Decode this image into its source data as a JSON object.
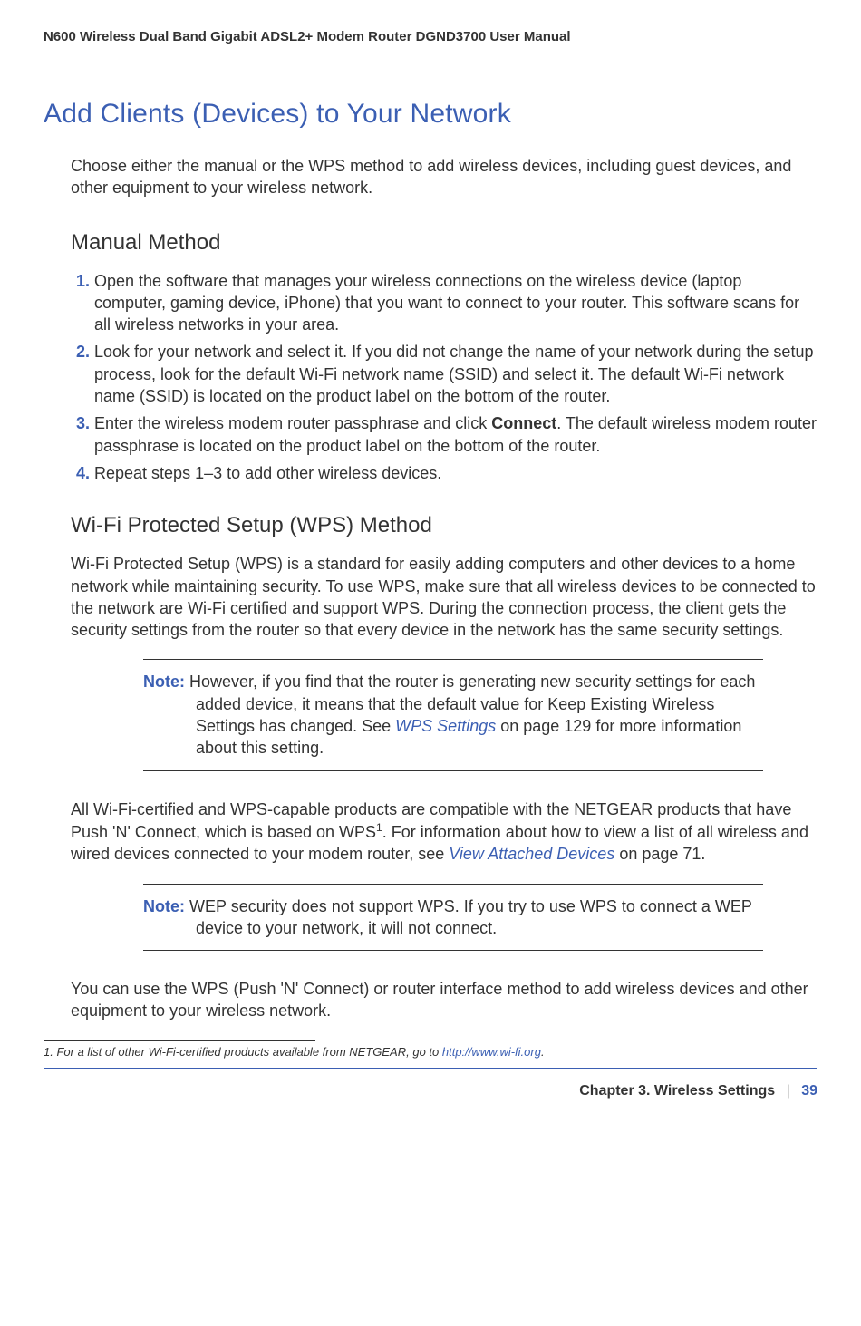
{
  "header": {
    "manual_title": "N600 Wireless Dual Band Gigabit ADSL2+ Modem Router DGND3700 User Manual"
  },
  "section": {
    "title": "Add Clients (Devices) to Your Network",
    "intro": "Choose either the manual or the WPS method to add wireless devices, including guest devices, and other equipment to your wireless network."
  },
  "manual": {
    "title": "Manual Method",
    "steps": [
      "Open the software that manages your wireless connections on the wireless device (laptop computer, gaming device, iPhone) that you want to connect to your router. This software scans for all wireless networks in your area.",
      "Look for your network and select it. If you did not change the name of your network during the setup process, look for the default Wi-Fi network name (SSID) and select it. The default Wi-Fi network name (SSID) is located on the product label on the bottom of the router.",
      "Enter the wireless modem router passphrase and click Connect. The default wireless modem router passphrase is located on the product label on the bottom of the router.",
      "Repeat steps 1–3 to add other wireless devices."
    ],
    "step3_pre": "Enter the wireless modem router passphrase and click ",
    "step3_bold": "Connect",
    "step3_post": ". The default wireless modem router passphrase is located on the product label on the bottom of the router."
  },
  "wps": {
    "title": "Wi-Fi Protected Setup (WPS) Method",
    "intro": "Wi-Fi Protected Setup (WPS) is a standard for easily adding computers and other devices to a home network while maintaining security. To use WPS, make sure that all wireless devices to be connected to the network are Wi-Fi certified and support WPS. During the connection process, the client gets the security settings from the router so that every device in the network has the same security settings.",
    "note1_label": "Note:",
    "note1_pre": "However, if you find that the router is generating new security settings for each added device, it means that the default value for Keep Existing Wireless Settings has changed. See ",
    "note1_link": "WPS Settings",
    "note1_post": " on page 129 for more information about this setting.",
    "compat_pre": "All Wi-Fi-certified and WPS-capable products are compatible with the NETGEAR products that have Push 'N' Connect, which is based on WPS",
    "compat_sup": "1",
    "compat_mid": ". For information about how to view a list of all wireless and wired devices connected to your modem router, see ",
    "compat_link": "View Attached Devices",
    "compat_post": " on page 71.",
    "note2_label": "Note:",
    "note2_text": "WEP security does not support WPS. If you try to use WPS to connect a WEP device to your network, it will not connect.",
    "closing": "You can use the WPS (Push 'N' Connect) or router interface method to add wireless devices and other equipment to your wireless network."
  },
  "footnote": {
    "num": "1.",
    "text_pre": " For a list of other Wi-Fi-certified products available from NETGEAR, go to ",
    "link": "http://www.wi-fi.org",
    "text_post": "."
  },
  "footer": {
    "chapter": "Chapter 3.  Wireless Settings",
    "sep": "|",
    "page": "39"
  }
}
